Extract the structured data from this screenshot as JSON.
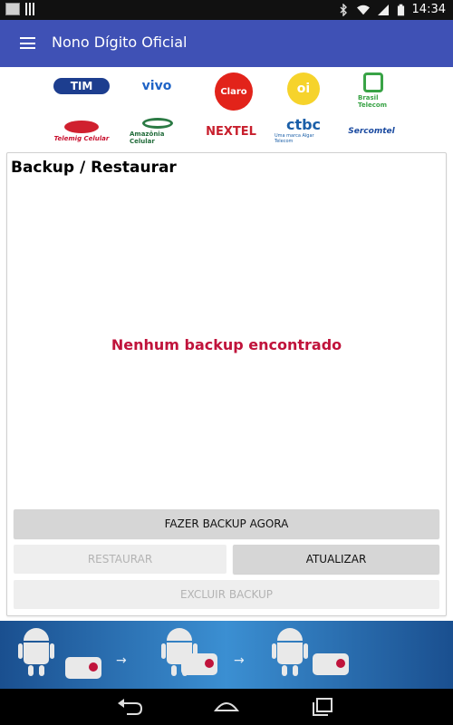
{
  "status_bar": {
    "time": "14:34"
  },
  "app_bar": {
    "title": "Nono Dígito Oficial"
  },
  "carriers": {
    "tim": "TIM",
    "vivo": "vivo",
    "claro": "Claro",
    "oi": "oi",
    "brasil_telecom": "Brasil Telecom",
    "telemig": "Telemig Celular",
    "amazonia": "Amazônia Celular",
    "nextel": "NEXTEL",
    "ctbc": "ctbc",
    "ctbc_tagline": "Uma marca Algar Telecom",
    "sercomtel": "Sercomtel"
  },
  "card": {
    "title": "Backup / Restaurar",
    "empty_message": "Nenhum backup encontrado",
    "buttons": {
      "backup_now": "FAZER BACKUP AGORA",
      "restore": "RESTAURAR",
      "update": "ATUALIZAR",
      "delete_backup": "EXCLUIR BACKUP"
    }
  },
  "colors": {
    "app_bar": "#3f51b5",
    "empty_message": "#c0133b",
    "status_bar": "#111111"
  }
}
